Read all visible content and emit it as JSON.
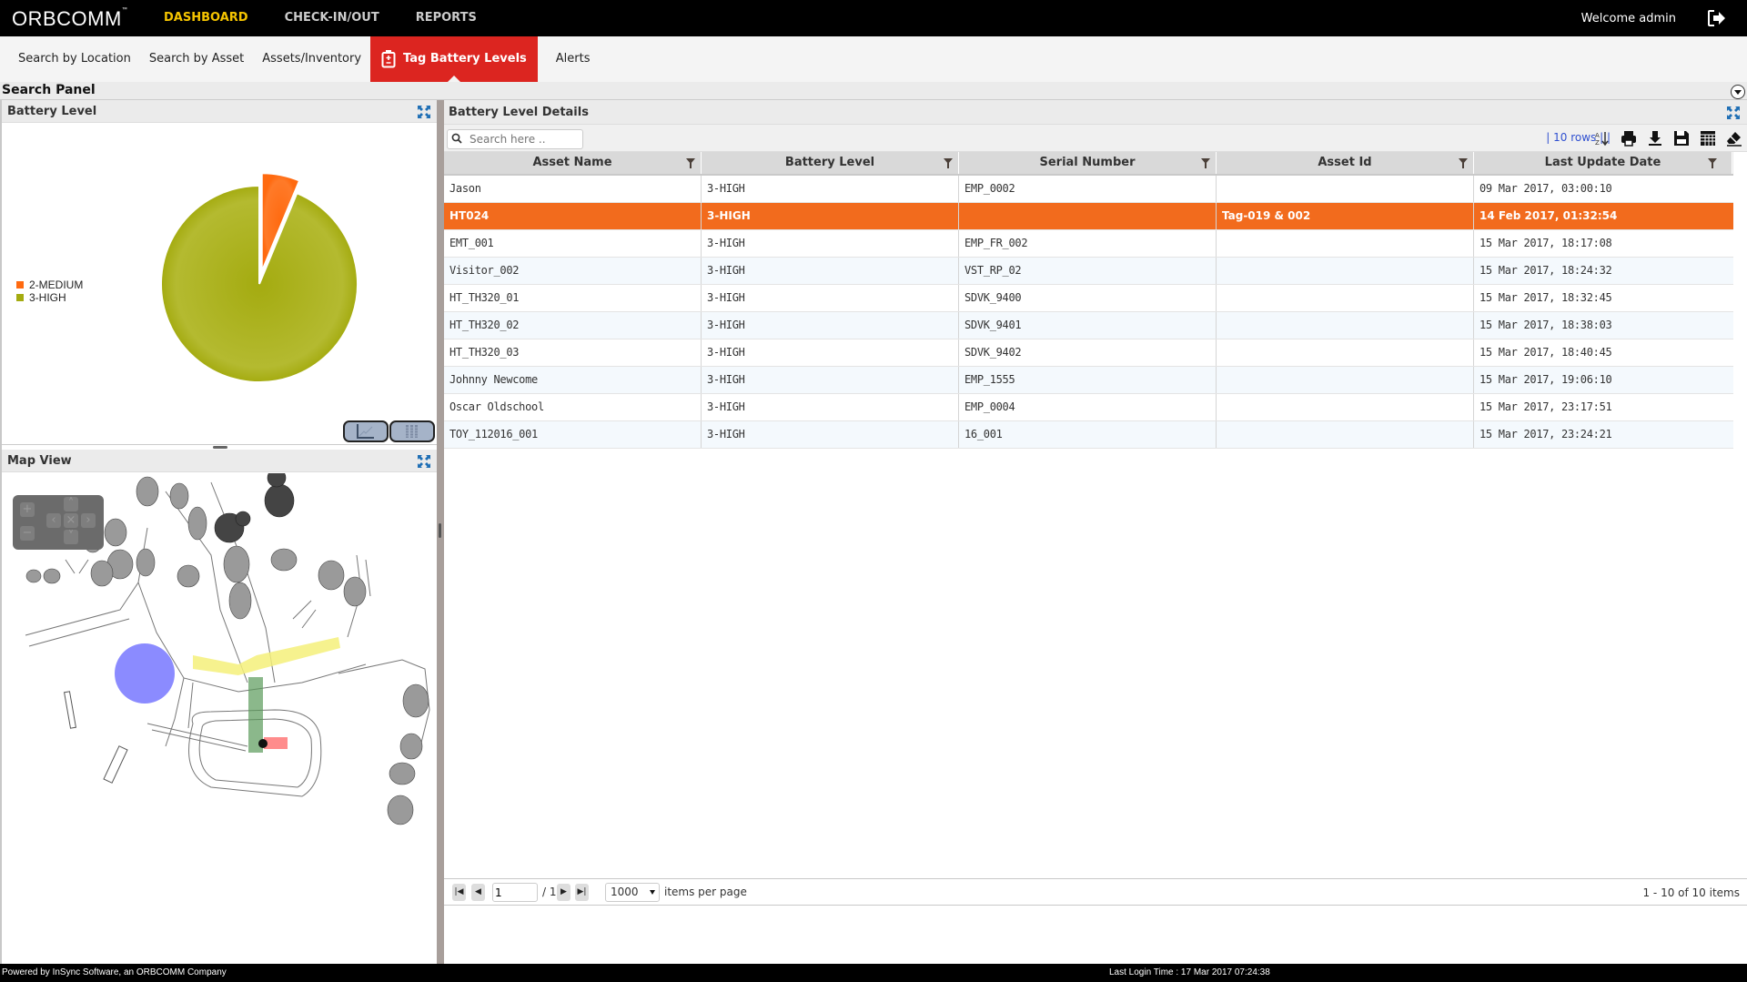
{
  "app": {
    "logo": "ORBCOMM",
    "welcome": "Welcome admin",
    "logout_icon": "logout-icon"
  },
  "topnav": [
    {
      "label": "DASHBOARD",
      "active": true
    },
    {
      "label": "CHECK-IN/OUT",
      "active": false
    },
    {
      "label": "REPORTS",
      "active": false
    }
  ],
  "subnav": [
    {
      "label": "Search by Location"
    },
    {
      "label": "Search by Asset"
    },
    {
      "label": "Assets/Inventory"
    },
    {
      "label": "Tag Battery Levels",
      "active": true,
      "icon": "battery-icon"
    },
    {
      "label": "Alerts"
    }
  ],
  "search_panel": {
    "title": "Search Panel"
  },
  "battery_panel": {
    "title": "Battery Level",
    "legend": [
      {
        "label": "2-MEDIUM",
        "color": "#ff6a10"
      },
      {
        "label": "3-HIGH",
        "color": "#a4ab10"
      }
    ]
  },
  "chart_data": {
    "type": "pie",
    "title": "Battery Level",
    "categories": [
      "2-MEDIUM",
      "3-HIGH"
    ],
    "values": [
      1,
      15
    ],
    "colors": [
      "#ff6a10",
      "#a4ab10"
    ],
    "exploded": [
      "2-MEDIUM"
    ],
    "legend": "left"
  },
  "map_panel": {
    "title": "Map View"
  },
  "details": {
    "title": "Battery Level Details",
    "search_placeholder": "Search here ..",
    "rows_info": "| 10 rows | |",
    "columns": [
      "Asset Name",
      "Battery Level",
      "Serial Number",
      "Asset Id",
      "Last Update Date"
    ],
    "rows": [
      [
        "Jason",
        "3-HIGH",
        "EMP_0002",
        "",
        "09 Mar 2017, 03:00:10"
      ],
      [
        "HT024",
        "3-HIGH",
        "",
        "Tag-019 & 002",
        "14 Feb 2017, 01:32:54"
      ],
      [
        "EMT_001",
        "3-HIGH",
        "EMP_FR_002",
        "",
        "15 Mar 2017, 18:17:08"
      ],
      [
        "Visitor_002",
        "3-HIGH",
        "VST_RP_02",
        "",
        "15 Mar 2017, 18:24:32"
      ],
      [
        "HT_TH320_01",
        "3-HIGH",
        "SDVK_9400",
        "",
        "15 Mar 2017, 18:32:45"
      ],
      [
        "HT_TH320_02",
        "3-HIGH",
        "SDVK_9401",
        "",
        "15 Mar 2017, 18:38:03"
      ],
      [
        "HT_TH320_03",
        "3-HIGH",
        "SDVK_9402",
        "",
        "15 Mar 2017, 18:40:45"
      ],
      [
        "Johnny Newcome",
        "3-HIGH",
        "EMP_1555",
        "",
        "15 Mar 2017, 19:06:10"
      ],
      [
        "Oscar Oldschool",
        "3-HIGH",
        "EMP_0004",
        "",
        "15 Mar 2017, 23:17:51"
      ],
      [
        "TOY_112016_001",
        "3-HIGH",
        "16_001",
        "",
        "15 Mar 2017, 23:24:21"
      ]
    ],
    "selected_row": 1,
    "pager": {
      "page": "1",
      "of": "/ 1",
      "per_page": "1000",
      "per_page_label": "items per page",
      "count": "1 - 10 of 10 items"
    }
  },
  "footer": {
    "powered": "Powered by InSync Software, an ORBCOMM Company",
    "last_login": "Last Login Time : 17 Mar 2017 07:24:38"
  }
}
